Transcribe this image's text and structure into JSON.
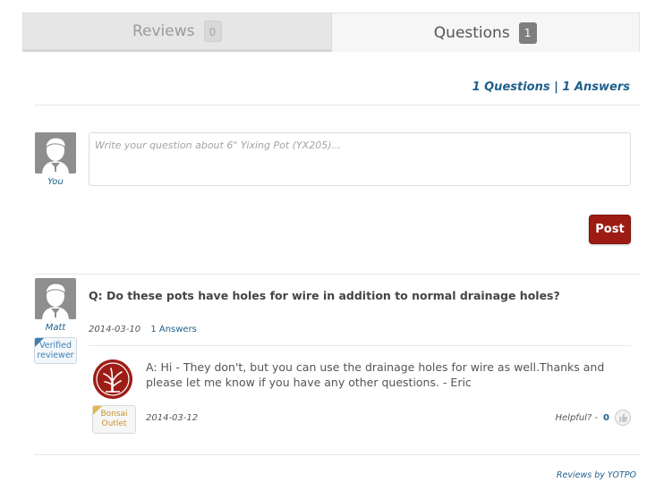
{
  "tabs": [
    {
      "label": "Reviews",
      "count": "0"
    },
    {
      "label": "Questions",
      "count": "1"
    }
  ],
  "summary": {
    "text": "1 Questions | 1 Answers"
  },
  "ask": {
    "user_label": "You",
    "placeholder": "Write your question about 6\" Yixing Pot (YX205)...",
    "post_label": "Post"
  },
  "question": {
    "author": "Matt",
    "verified_label": "Verified reviewer",
    "text": "Q: Do these pots have holes for wire in addition to normal drainage holes?",
    "date": "2014-03-10",
    "answers_link": "1 Answers"
  },
  "answer": {
    "text": "A: Hi - They don't, but you can use the drainage holes for wire as well.Thanks and please let me know if you have any other questions. - Eric",
    "store_badge_label": "Bonsai Outlet",
    "date": "2014-03-12",
    "helpful_label": "Helpful? -",
    "helpful_count": "0"
  },
  "footer": {
    "text": "Reviews by YOTPO"
  },
  "colors": {
    "accent": "#1e5f8c",
    "post_button": "#9c1c14",
    "logo": "#9e1d17"
  },
  "icons": [
    "user-avatar-icon",
    "verified-check-icon",
    "bonsai-tree-icon",
    "store-badge-icon",
    "thumbs-up-icon"
  ]
}
